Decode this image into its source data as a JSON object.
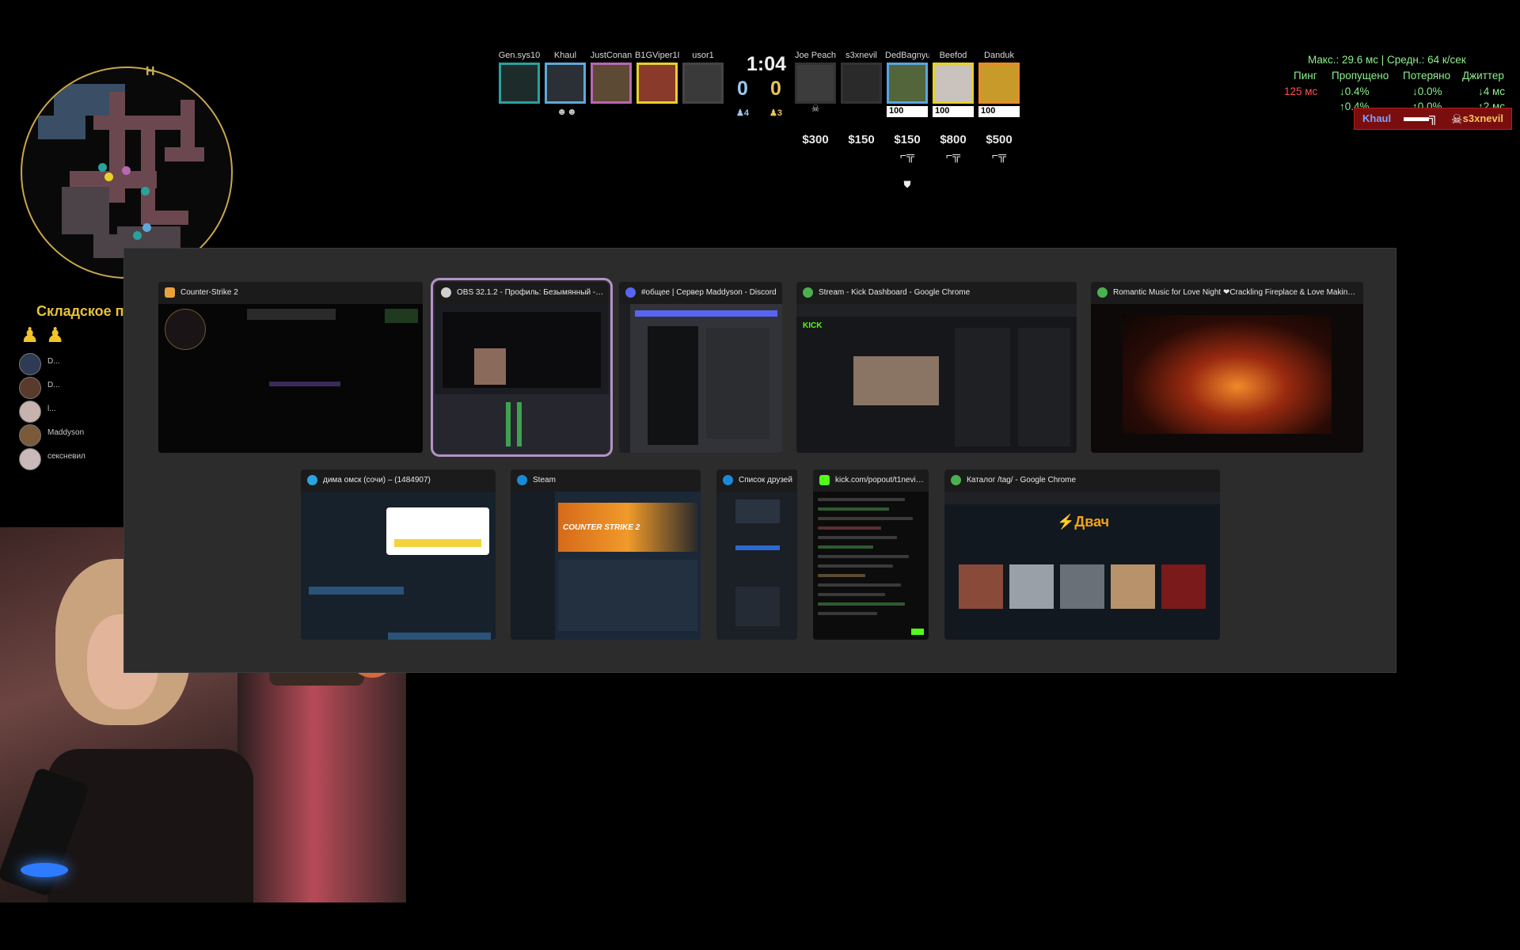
{
  "minimap": {
    "site_label": "H"
  },
  "scoreboard": {
    "timer": "1:04",
    "ct_score": "0",
    "t_score": "0",
    "ct_alive": "♟4",
    "t_alive": "♟3",
    "ct_players": [
      {
        "name": "Gen.sys10",
        "color": "#2aa19d"
      },
      {
        "name": "Khaul",
        "color": "#5fa8d8"
      },
      {
        "name": "JustConan",
        "color": "#b867b0"
      },
      {
        "name": "B1GViper187",
        "color": "#e6d12a"
      },
      {
        "name": "usor1",
        "color": "#555555"
      }
    ],
    "t_players": [
      {
        "name": "Joe Peach",
        "money": "$300",
        "dead": "☠"
      },
      {
        "name": "s3xnevil",
        "money": "$150",
        "dead": ""
      },
      {
        "name": "DedBagnyuk",
        "hp": "100",
        "money": "$150",
        "gun": "⌐╦",
        "color": "#58a6e0"
      },
      {
        "name": "Beefod",
        "hp": "100",
        "money": "$800",
        "gun": "⌐╦",
        "color": "#e6d12a"
      },
      {
        "name": "Danduk",
        "hp": "100",
        "money": "$500",
        "gun": "⌐╦",
        "color": "#ea8b25"
      }
    ],
    "defuse_icon": "⛊",
    "ct_dead_icons": "☻☻"
  },
  "netstats": {
    "row1": "Макс.: 29.6 мс | Средн.: 64 к/сек",
    "headers": [
      "Пинг",
      "Пропущено",
      "Потеряно",
      "Джиттер"
    ],
    "ping": "125 мс",
    "down": [
      "↓0.4%",
      "↓0.0%",
      "↓4 мс"
    ],
    "up": [
      "↑0.4%",
      "↑0.0%",
      "↑2 мс"
    ]
  },
  "killfeed": {
    "attacker": "Khaul",
    "victim": "s3xnevil"
  },
  "left": {
    "zone_title": "Складское п",
    "voice": [
      {
        "name": "D..."
      },
      {
        "name": "D..."
      },
      {
        "name": "l..."
      },
      {
        "name": "Maddyson"
      },
      {
        "name": "сексневил"
      }
    ]
  },
  "windows": [
    {
      "title": "Counter-Strike 2",
      "icon_color": "#e9a23b"
    },
    {
      "title": "OBS 32.1.2 - Профиль: Безымянный - Сц...",
      "icon_color": "#cfcfcf"
    },
    {
      "title": "#общее | Сервер Maddyson - Discord",
      "icon_color": "#5865f2"
    },
    {
      "title": "Stream - Kick Dashboard - Google Chrome",
      "icon_color": "#4caf50"
    },
    {
      "title": "Romantic Music for Love Night ❤Crackling Fireplace & Love Making Music...",
      "icon_color": "#4caf50"
    },
    {
      "title": "дима омск (сочи) – (1484907)",
      "icon_color": "#2aa3e0"
    },
    {
      "title": "Steam",
      "icon_color": "#1b8ad6"
    },
    {
      "title": "Список друзей",
      "icon_color": "#1b8ad6"
    },
    {
      "title": "kick.com/popout/t1nevil/c...",
      "icon_color": "#53fc18"
    },
    {
      "title": "Каталог /tag/ - Google Chrome",
      "icon_color": "#4caf50"
    }
  ],
  "content": {
    "kick_logo": "KICK",
    "dvach_logo": "Двач",
    "cs2_banner": "COUNTER STRIKE 2"
  }
}
